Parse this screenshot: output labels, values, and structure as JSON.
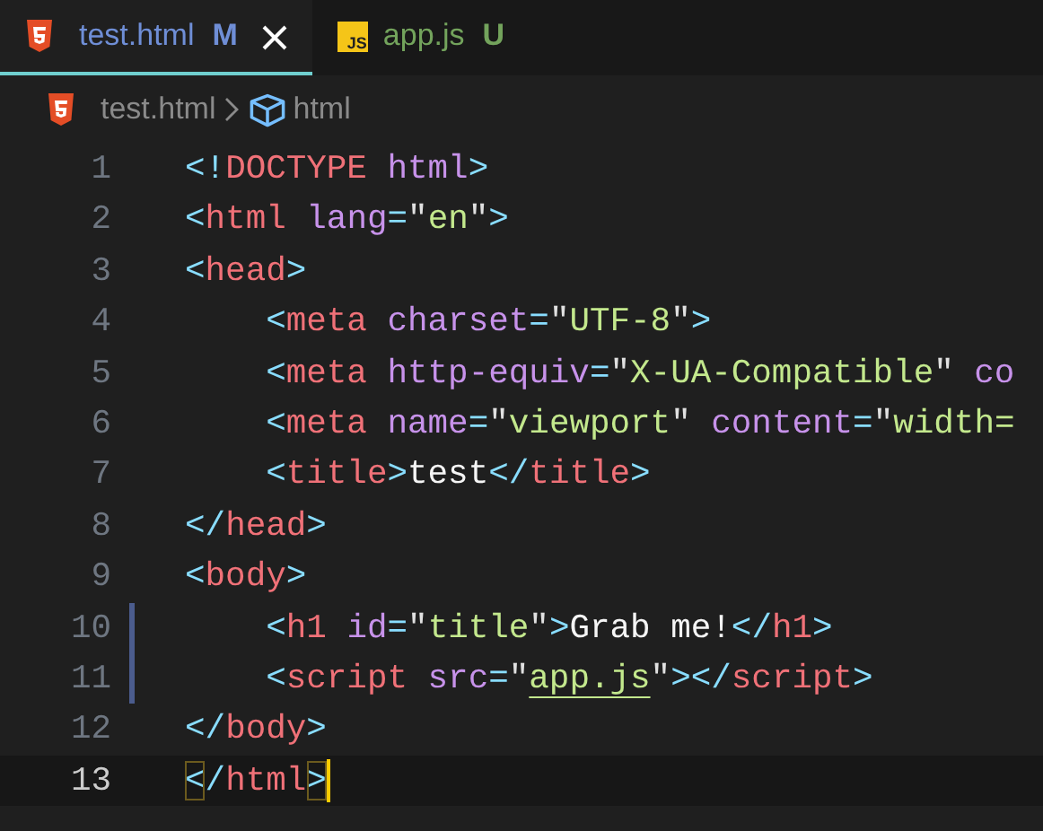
{
  "tabs": [
    {
      "label": "test.html",
      "badge": "M",
      "kind": "html",
      "color": "#6f8ed6",
      "selected": true
    },
    {
      "label": "app.js",
      "badge": "U",
      "kind": "js",
      "icon_label": "JS",
      "color": "#73a35c",
      "selected": false
    }
  ],
  "breadcrumb": [
    {
      "label": "test.html",
      "kind": "file"
    },
    {
      "label": "html",
      "kind": "element"
    }
  ],
  "lines": [
    {
      "number": "1",
      "modified": false,
      "current": false,
      "code": "<!DOCTYPE html>"
    },
    {
      "number": "2",
      "modified": false,
      "current": false,
      "code": "<html lang=\"en\">"
    },
    {
      "number": "3",
      "modified": false,
      "current": false,
      "code": "<head>"
    },
    {
      "number": "4",
      "modified": false,
      "current": false,
      "code": "    <meta charset=\"UTF-8\">"
    },
    {
      "number": "5",
      "modified": false,
      "current": false,
      "code": "    <meta http-equiv=\"X-UA-Compatible\" co"
    },
    {
      "number": "6",
      "modified": false,
      "current": false,
      "code": "    <meta name=\"viewport\" content=\"width="
    },
    {
      "number": "7",
      "modified": false,
      "current": false,
      "code": "    <title>test</title>"
    },
    {
      "number": "8",
      "modified": false,
      "current": false,
      "code": "</head>"
    },
    {
      "number": "9",
      "modified": false,
      "current": false,
      "code": "<body>"
    },
    {
      "number": "10",
      "modified": true,
      "current": false,
      "code": "    <h1 id=\"title\">Grab me!</h1>"
    },
    {
      "number": "11",
      "modified": true,
      "current": false,
      "link_underlined": true,
      "code": "    <script src=\"app.js\"></script>"
    },
    {
      "number": "12",
      "modified": false,
      "current": false,
      "code": "</body>"
    },
    {
      "number": "13",
      "modified": false,
      "current": true,
      "bracket_match": true,
      "code": "</html>"
    }
  ]
}
